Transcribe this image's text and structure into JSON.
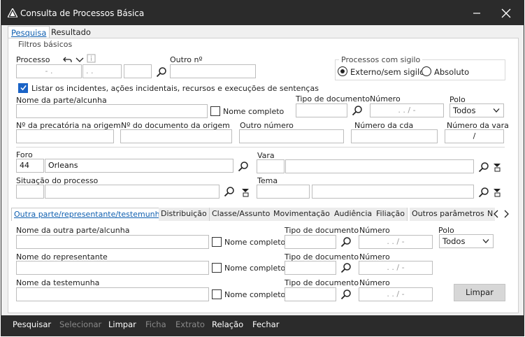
{
  "window": {
    "title": "Consulta de Processos Básica"
  },
  "tabs_top": [
    {
      "label": "Pesquisa",
      "active": true
    },
    {
      "label": "Resultado",
      "active": false
    }
  ],
  "filtros": {
    "group_title": "Filtros básicos",
    "processo_label": "Processo",
    "processo_part1": "- .",
    "processo_part2": ". .",
    "processo_part3": "",
    "outro_label": "Outro nº",
    "outro_value": "",
    "sigilo_title": "Processos com sigilo",
    "sigilo_opt1": "Externo/sem sigilo",
    "sigilo_opt2": "Absoluto",
    "listar_label": "Listar os incidentes, ações incidentais, recursos e execuções de sentenças",
    "parte_label": "Nome da parte/alcunha",
    "nome_completo": "Nome completo",
    "tipo_doc_label": "Tipo de documento",
    "numero_label": "Número",
    "numero_value": ". . / -",
    "polo_label": "Polo",
    "polo_value": "Todos",
    "precatoria_label": "Nº da precatória na origem",
    "doc_origem_label": "Nº do documento da origem",
    "outro_numero_label": "Outro número",
    "cda_label": "Número da cda",
    "vara_num_label": "Número da vara",
    "vara_num_value": "/",
    "foro_label": "Foro",
    "foro_code": "44",
    "foro_name": "Orleans",
    "vara_label": "Vara",
    "situacao_label": "Situação do processo",
    "tema_label": "Tema"
  },
  "tabs_mid": [
    "Outra parte/representante/testemunha",
    "Distribuição",
    "Classe/Assunto",
    "Movimentação",
    "Audiência",
    "Filiação",
    "Outros parâmetros",
    "N"
  ],
  "outra": {
    "nome_outra_label": "Nome da outra parte/alcunha",
    "nome_repr_label": "Nome do representante",
    "nome_test_label": "Nome da testemunha",
    "nome_completo": "Nome completo",
    "tipo_doc_label": "Tipo de documento",
    "numero_label": "Número",
    "numero_value": ". . / -",
    "polo_label": "Polo",
    "polo_value": "Todos",
    "limpar_btn": "Limpar"
  },
  "bottom_bar": [
    {
      "label": "Pesquisar",
      "enabled": true
    },
    {
      "label": "Selecionar",
      "enabled": false
    },
    {
      "label": "Limpar",
      "enabled": true
    },
    {
      "label": "Ficha",
      "enabled": false
    },
    {
      "label": "Extrato",
      "enabled": false
    },
    {
      "label": "Relação",
      "enabled": true
    },
    {
      "label": "Fechar",
      "enabled": true
    }
  ],
  "colors": {
    "titlebar": "#2b2b2b",
    "accent": "#1a63c6",
    "tab_active_text": "#0f5fb0"
  },
  "icons": [
    "app-icon",
    "minimize-icon",
    "close-icon",
    "undo-icon",
    "chevron-down-icon",
    "info-icon",
    "search-icon",
    "filter-icon",
    "chevron-left-icon",
    "chevron-right-icon"
  ]
}
